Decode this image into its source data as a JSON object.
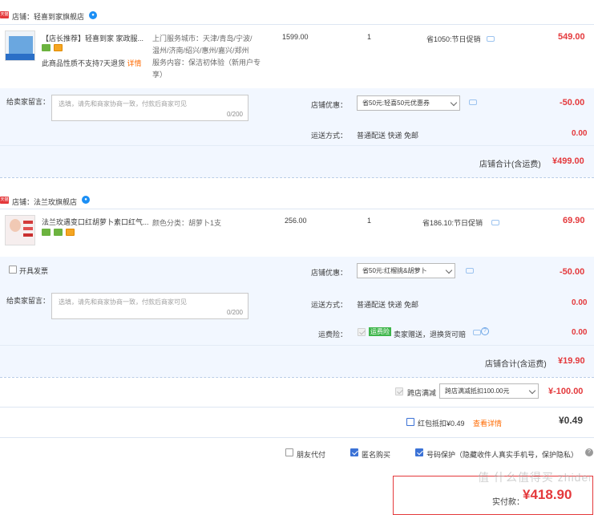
{
  "shop1": {
    "tag": "天猫",
    "name": "店铺：轻喜到家旗舰店",
    "product": {
      "title": "【店长推荐】轻喜到家 家政服...",
      "notice": "此商品性质不支持7天退货",
      "notice_link": "详情",
      "attrs": [
        "上门服务城市：天津/青岛/宁波/",
        "温州/济南/绍兴/惠州/嘉兴/郑州",
        "服务内容：保洁初体验（新用户专",
        "享）"
      ],
      "price": "1599.00",
      "qty": "1",
      "discount": "省1050:节日促销",
      "total": "549.00"
    },
    "message_label": "给卖家留言：",
    "message_placeholder": "选填，请先和商家协商一致，付款后商家可见",
    "message_count": "0/200",
    "coupon_label": "店铺优惠：",
    "coupon_value": "省50元:轻喜50元优惠券",
    "coupon_amount": "-50.00",
    "shipping_label": "运送方式：",
    "shipping_value": "普通配送 快递 免邮",
    "shipping_amount": "0.00",
    "subtotal_label": "店铺合计(含运费)",
    "subtotal_value": "¥499.00"
  },
  "shop2": {
    "tag": "天猫",
    "name": "店铺：法兰玫旗舰店",
    "product": {
      "title": "法兰玫遇变口红胡萝卜素口红气...",
      "attrs": [
        "颜色分类：胡萝卜1支"
      ],
      "price": "256.00",
      "qty": "1",
      "discount": "省186.10:节日促销",
      "total": "69.90"
    },
    "invoice_label": "开具发票",
    "message_label": "给卖家留言：",
    "message_placeholder": "选填，请先和商家协商一致，付款后商家可见",
    "message_count": "0/200",
    "coupon_label": "店铺优惠：",
    "coupon_value": "省50元:红榴挑&胡萝卜",
    "coupon_amount": "-50.00",
    "shipping_label": "运送方式：",
    "shipping_value": "普通配送 快递 免邮",
    "shipping_amount": "0.00",
    "insurance_label": "运费险：",
    "insurance_tag": "运费险",
    "insurance_text": "卖家赠送，退换货可赔",
    "insurance_amount": "0.00",
    "subtotal_label": "店铺合计(含运费)",
    "subtotal_value": "¥19.90"
  },
  "cross_store": {
    "label": "跨店满减",
    "select_value": "跨店满减抵扣100.00元",
    "amount": "¥-100.00"
  },
  "redpacket": {
    "label": "红包抵扣¥0.49",
    "link": "查看详情",
    "amount": "¥0.49"
  },
  "options": {
    "friend_pay": "朋友代付",
    "anonymous": "匿名购买",
    "number_protect": "号码保护（隐藏收件人真实手机号，保护隐私）"
  },
  "footer": {
    "pay_label": "实付款：",
    "pay_value": "¥418.90"
  },
  "watermark": "值 什么值得买 zhidemai",
  "colors": {
    "accent": "#e4393c",
    "band": "#f2f7ff",
    "link": "#ff6a00",
    "check": "#3b72d6"
  }
}
